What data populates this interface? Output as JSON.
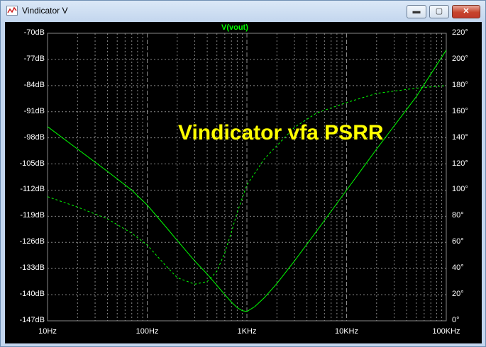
{
  "window": {
    "title": "Vindicator V",
    "icon": "waveform-app-icon"
  },
  "controls": {
    "minimize": "▬",
    "maximize": "▢",
    "close": "✕"
  },
  "colors": {
    "background": "#000000",
    "grid": "#888888",
    "trace": "#00ff00",
    "annotation": "#ffff00",
    "text": "#ffffff"
  },
  "chart_data": {
    "type": "line",
    "title": "V(vout)",
    "annotation": "Vindicator vfa PSRR",
    "x_scale": "log",
    "xlim": [
      10,
      100000
    ],
    "x_ticks": [
      {
        "value": 10,
        "label": "10Hz"
      },
      {
        "value": 100,
        "label": "100Hz"
      },
      {
        "value": 1000,
        "label": "1KHz"
      },
      {
        "value": 10000,
        "label": "10KHz"
      },
      {
        "value": 100000,
        "label": "100KHz"
      }
    ],
    "ylim_left": [
      -147,
      -70
    ],
    "y_ticks_left": [
      "-70dB",
      "-77dB",
      "-84dB",
      "-91dB",
      "-98dB",
      "-105dB",
      "-112dB",
      "-119dB",
      "-126dB",
      "-133dB",
      "-140dB",
      "-147dB"
    ],
    "ylim_right": [
      0,
      220
    ],
    "y_ticks_right": [
      "220°",
      "200°",
      "180°",
      "160°",
      "140°",
      "120°",
      "100°",
      "80°",
      "60°",
      "40°",
      "20°",
      "0°"
    ],
    "grid": true,
    "series": [
      {
        "axis": "left",
        "style": "solid",
        "x": [
          10,
          20,
          40,
          70,
          100,
          150,
          200,
          300,
          400,
          500,
          600,
          700,
          800,
          900,
          1000,
          1200,
          1500,
          2000,
          3000,
          5000,
          10000,
          20000,
          50000,
          100000
        ],
        "y": [
          -95,
          -101,
          -107,
          -112,
          -116,
          -121.5,
          -125.5,
          -131,
          -134.5,
          -137.5,
          -140,
          -142,
          -143.5,
          -144.3,
          -144.5,
          -143.2,
          -140.8,
          -137,
          -131,
          -123,
          -112,
          -101,
          -87,
          -74.5
        ]
      },
      {
        "axis": "right",
        "style": "dashed",
        "x": [
          10,
          20,
          40,
          70,
          100,
          150,
          200,
          300,
          400,
          500,
          600,
          700,
          800,
          1000,
          1500,
          2000,
          3000,
          5000,
          10000,
          20000,
          50000,
          100000
        ],
        "y": [
          95,
          87,
          78,
          67,
          58,
          43,
          33,
          28,
          30,
          38,
          52,
          68,
          83,
          104,
          124,
          134,
          148,
          159,
          167,
          174,
          178,
          180
        ]
      }
    ]
  }
}
